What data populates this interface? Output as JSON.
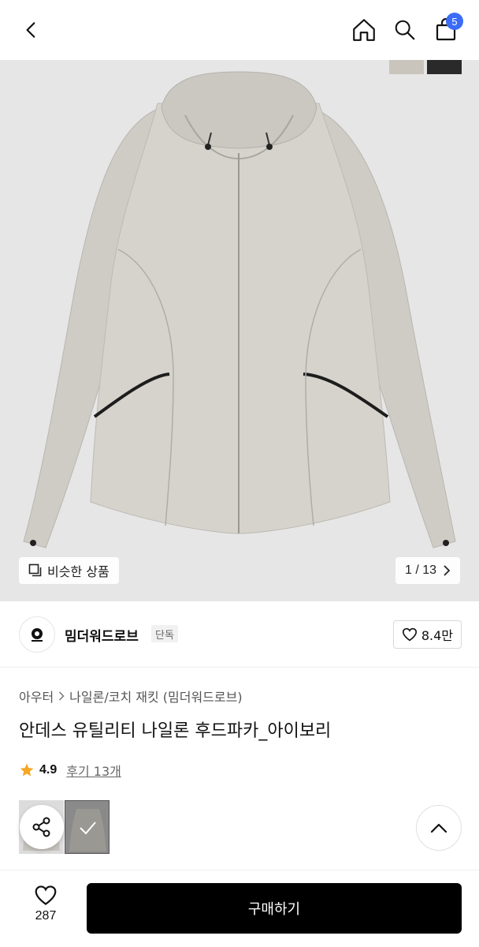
{
  "header": {
    "back_icon": "chevron-left-icon",
    "home_icon": "home-icon",
    "search_icon": "search-icon",
    "cart_icon": "shopping-bag-icon",
    "cart_count": "5",
    "badge_color": "#3b6cf6"
  },
  "gallery": {
    "similar_label": "비슷한 상품",
    "counter": "1 / 13",
    "swatch_colors": [
      "#c9c5bd",
      "#2a2a2a"
    ]
  },
  "brand": {
    "name": "밈더워드로브",
    "tag": "단독",
    "likes": "8.4만"
  },
  "product": {
    "breadcrumb_1": "아우터",
    "breadcrumb_2": "나일론/코치 재킷 (밈더워드로브)",
    "title": "안데스 유틸리티 나일론 후드파카_아이보리",
    "rating": "4.9",
    "reviews": "후기 13개"
  },
  "bottom": {
    "wish_count": "287",
    "buy_label": "구매하기"
  }
}
